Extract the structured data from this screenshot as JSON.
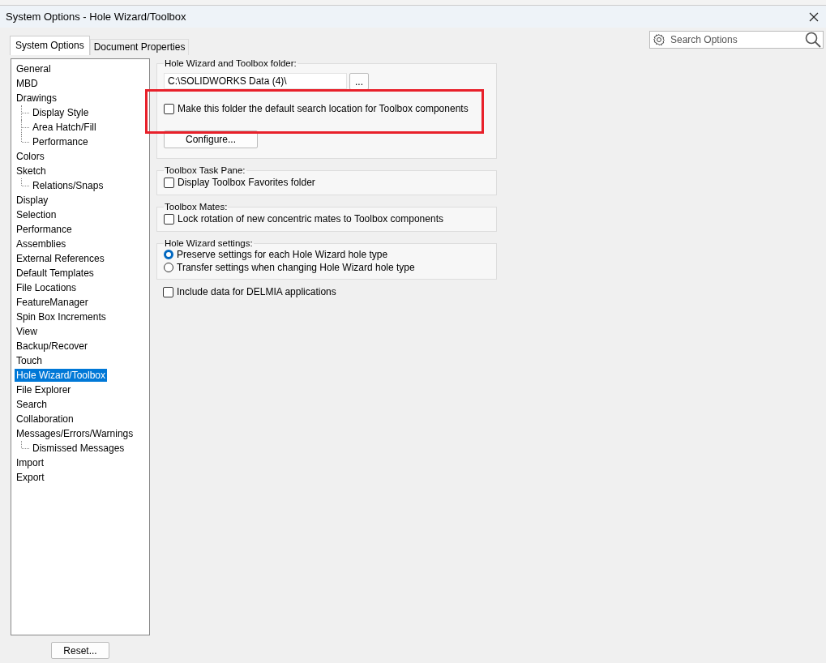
{
  "window": {
    "title": "System Options - Hole Wizard/Toolbox"
  },
  "tabs": [
    {
      "label": "System Options",
      "selected": true
    },
    {
      "label": "Document Properties",
      "selected": false
    }
  ],
  "search": {
    "placeholder": "Search Options"
  },
  "sidebar": {
    "items": [
      {
        "label": "General",
        "selected": false
      },
      {
        "label": "MBD",
        "selected": false
      },
      {
        "label": "Drawings",
        "selected": false,
        "children": [
          {
            "label": "Display Style",
            "selected": false
          },
          {
            "label": "Area Hatch/Fill",
            "selected": false
          },
          {
            "label": "Performance",
            "selected": false
          }
        ]
      },
      {
        "label": "Colors",
        "selected": false
      },
      {
        "label": "Sketch",
        "selected": false,
        "children": [
          {
            "label": "Relations/Snaps",
            "selected": false
          }
        ]
      },
      {
        "label": "Display",
        "selected": false
      },
      {
        "label": "Selection",
        "selected": false
      },
      {
        "label": "Performance",
        "selected": false
      },
      {
        "label": "Assemblies",
        "selected": false
      },
      {
        "label": "External References",
        "selected": false
      },
      {
        "label": "Default Templates",
        "selected": false
      },
      {
        "label": "File Locations",
        "selected": false
      },
      {
        "label": "FeatureManager",
        "selected": false
      },
      {
        "label": "Spin Box Increments",
        "selected": false
      },
      {
        "label": "View",
        "selected": false
      },
      {
        "label": "Backup/Recover",
        "selected": false
      },
      {
        "label": "Touch",
        "selected": false
      },
      {
        "label": "Hole Wizard/Toolbox",
        "selected": true
      },
      {
        "label": "File Explorer",
        "selected": false
      },
      {
        "label": "Search",
        "selected": false
      },
      {
        "label": "Collaboration",
        "selected": false
      },
      {
        "label": "Messages/Errors/Warnings",
        "selected": false,
        "children": [
          {
            "label": "Dismissed Messages",
            "selected": false
          }
        ]
      },
      {
        "label": "Import",
        "selected": false
      },
      {
        "label": "Export",
        "selected": false
      }
    ],
    "reset_button": "Reset..."
  },
  "folder_group": {
    "title": "Hole Wizard and Toolbox folder:",
    "path": "C:\\SOLIDWORKS Data (4)\\",
    "browse_button": "...",
    "default_search": {
      "label": "Make this folder the default search location for Toolbox components",
      "checked": false
    },
    "configure_button": "Configure..."
  },
  "task_pane_group": {
    "title": "Toolbox Task Pane:",
    "options": [
      {
        "label": "Display Toolbox Favorites folder",
        "checked": false
      }
    ]
  },
  "mates_group": {
    "title": "Toolbox Mates:",
    "options": [
      {
        "label": "Lock rotation of new concentric mates to Toolbox components",
        "checked": false
      }
    ]
  },
  "hole_wizard_group": {
    "title": "Hole Wizard settings:",
    "radios": [
      {
        "label": "Preserve settings for each Hole Wizard hole type",
        "selected": true
      },
      {
        "label": "Transfer settings when changing Hole Wizard hole type",
        "selected": false
      }
    ]
  },
  "delmia": {
    "label": "Include data for DELMIA applications",
    "checked": false
  }
}
